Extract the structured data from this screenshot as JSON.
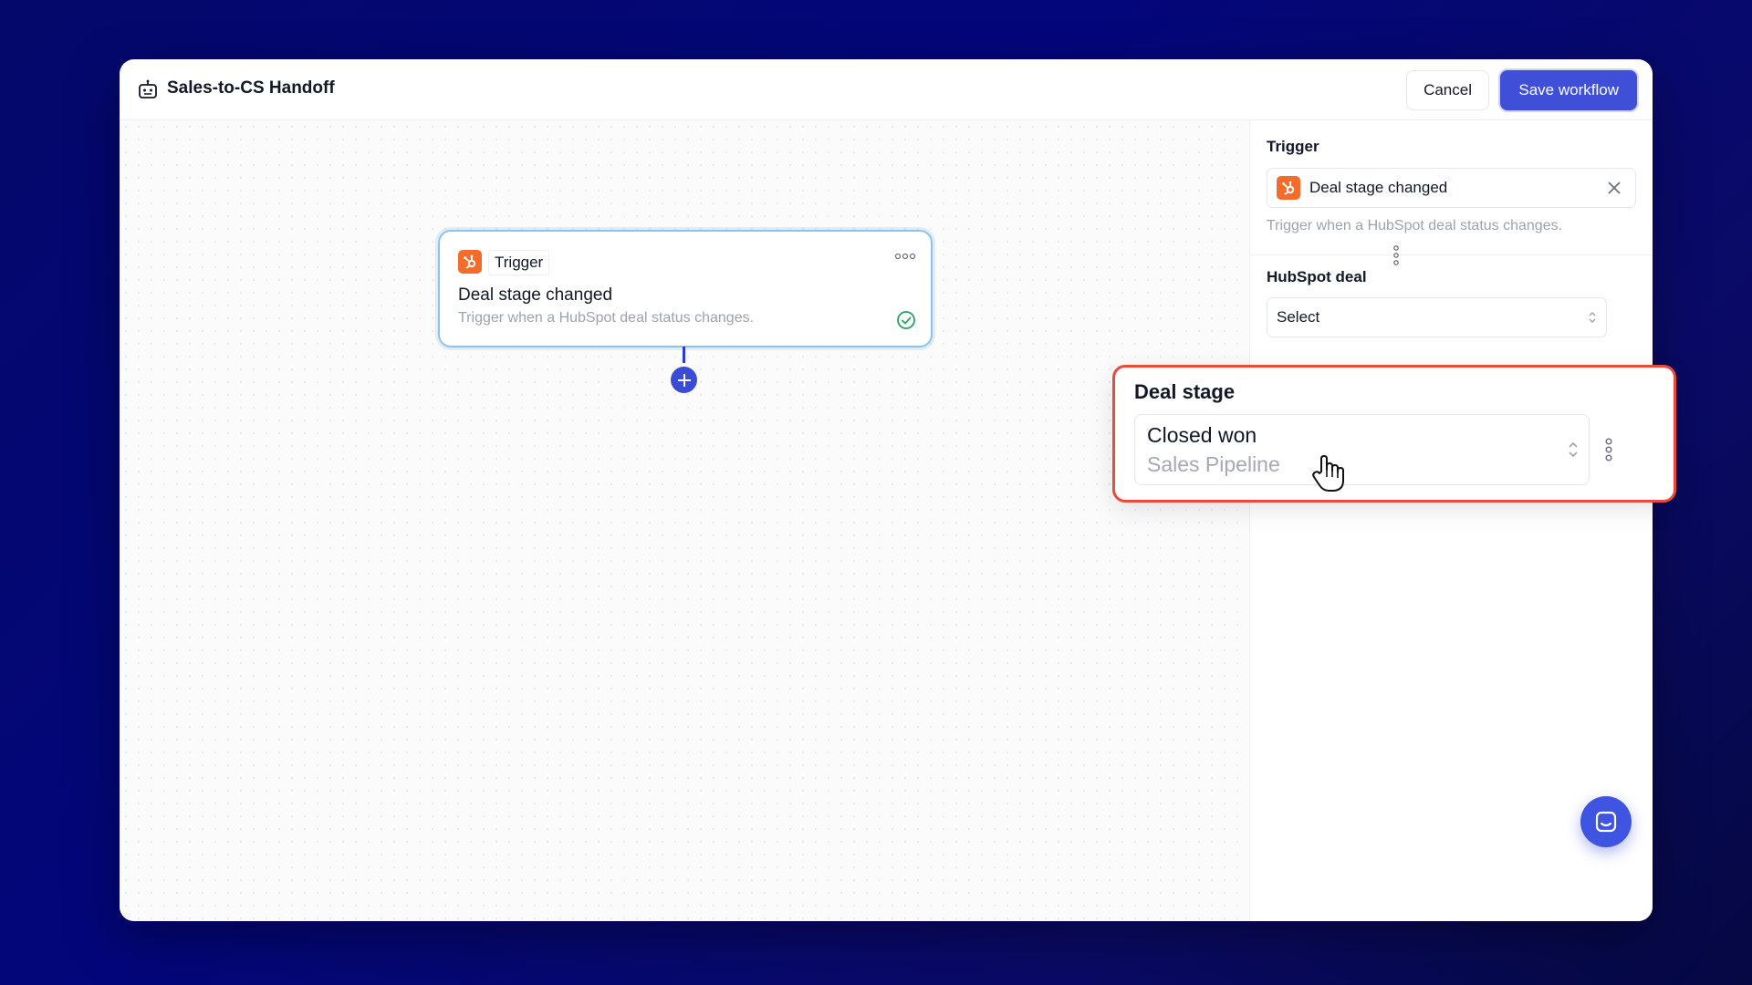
{
  "header": {
    "title": "Sales-to-CS Handoff",
    "cancel_label": "Cancel",
    "save_label": "Save workflow"
  },
  "node": {
    "tag": "Trigger",
    "title": "Deal stage changed",
    "description": "Trigger when a HubSpot deal status changes.",
    "status_icon": "check-circle-icon"
  },
  "panel": {
    "trigger_label": "Trigger",
    "trigger_value": "Deal stage changed",
    "trigger_help": "Trigger when a HubSpot deal status changes.",
    "deal_label": "HubSpot deal",
    "deal_value": "Select",
    "deal_stage_label": "Deal stage",
    "deal_stage_value": "Closed won",
    "deal_stage_pipeline": "Sales Pipeline"
  },
  "colors": {
    "background": "#03067a",
    "accent": "#3f4fd8",
    "hubspot": "#f46c2b",
    "highlight": "#ea4b3c",
    "success": "#22a55b"
  },
  "icons": {
    "app": "robot-icon",
    "hubspot": "hubspot-icon",
    "add": "plus-icon",
    "remove": "close-icon",
    "chat": "chat-icon"
  }
}
